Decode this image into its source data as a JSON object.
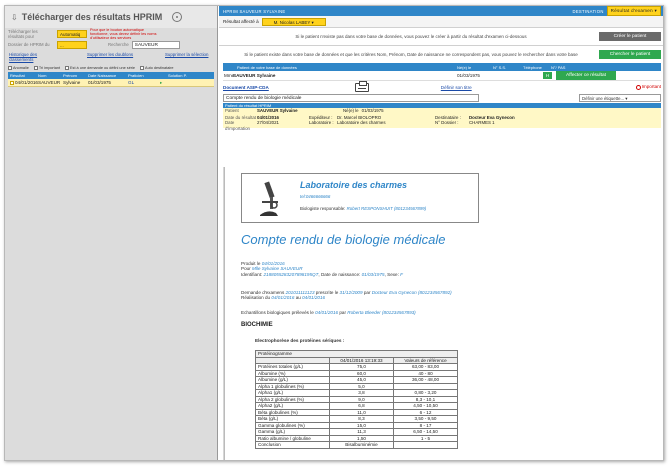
{
  "left": {
    "title": "Télécharger des résultats HPRIM",
    "telecharger_label": "Télécharger les résultats pour",
    "telecharger_value": "Automatiq",
    "warning": "Pour que le bouton automatique fonctionne, vous devez définir les noms d'utilisateur des services",
    "dossier_label": "Dossier de HPRIM du",
    "dossier_value": "...",
    "recherche_label": "Recherche",
    "recherche_value": "SAUVEUR",
    "links": [
      "Historique des classements",
      "Supprimer les doublons",
      "Supprimer la sélection"
    ],
    "checks": [
      "Anomalie",
      "Tri important",
      "Est à une demande ou défini une série",
      "Auto destinataire"
    ],
    "table_headers": [
      "Résultat",
      "Nom",
      "Prénom",
      "Date Naissance",
      "Praticien",
      "Solution P."
    ],
    "table_row": {
      "date": "04/01/2016",
      "nom": "SAUVEUR",
      "prenom": "Sylvaine",
      "naissance": "01/03/1975",
      "praticien": "GL"
    }
  },
  "right": {
    "topbar": "HPRIM SAUVEUR SYLVAINE",
    "destination_label": "DESTINATION",
    "destination_value": "Résultat d'examen",
    "affecte_label": "Résultat affecté à",
    "affecte_value": "M. Nicolas LABEY",
    "msg1": "Si le patient n'existe pas dans votre base de données, vous pouvez le créer à partir du résultat d'examen ci-dessous",
    "btn_create": "Créer le patient",
    "msg2": "Si le patient existe dans votre base de données et que les critères Nom, Prénom, Date de naissance ne correspondent pas, vous pouvez le rechercher dans votre base",
    "btn_search": "Chercher le patient",
    "pt_headers": [
      "Patient de votre base de données",
      "Né(e) le",
      "N° S.S.",
      "Téléphone",
      "N°/ PAS"
    ],
    "pt_row": {
      "civ": "Mme",
      "nom": "SAUVEUR Sylvaine",
      "naiss": "01/03/1975",
      "h": "H",
      "btn": "Affecter ce résultat"
    },
    "doc_label": "Document ASIP-CDA",
    "define_title": "Définir son titre",
    "important": "Important",
    "doc_title": "Compte rendu de biologie médicale",
    "dd": "Définir une étiquette...",
    "meta_bar": "Patient du résultat HPRIM",
    "meta": {
      "patient_k": "Patient",
      "patient_v": "SAUVEUR Sylvaine",
      "nele_k": "Né(e) le",
      "nele_v": "01/03/1975",
      "date_k": "Date du résultat",
      "date_v": "04/01/2016",
      "exp_k": "Expéditeur :",
      "exp_v": "Dr. Marcel BIOLOPRO",
      "dest_k": "Destinataire :",
      "dest_v": "Docteur Eva Gynecon",
      "imp_k": "Date d'importation",
      "imp_v": "27/04/2021",
      "lab_k": "Laboratoire :",
      "lab_v": "Laboratoire des charmes",
      "dos_k": "N° Dossier :",
      "dos_v": "CHARMES 1"
    }
  },
  "report": {
    "lab_name": "Laboratoire des charmes",
    "lab_tel": "tel:0466666666",
    "bio_label": "Biologiste responsable:",
    "bio_name": "Robert RESPONSHUIT (801234567899)",
    "h1": "Compte rendu de biologie médicale",
    "produit_le": "Produit le",
    "produit_date": "04/01/2016",
    "pour": "Pour",
    "pour_name": "Mlle Sylvaine SAUVEUR",
    "ident_label": "Identifiant:",
    "ident_value": "2188055283207898195QT",
    "naiss_label": ", Date de naissance:",
    "naiss_value": "01/03/1975",
    "sexe_label": ", Sexe:",
    "sexe_value": "F",
    "demande_label": "Demande d'examens",
    "demande_value": "201011111123",
    "prescrite": "prescrite le",
    "prescrite_date": "31/12/2009",
    "par": "par",
    "presc_name": "Docteur Eva Gynecon (801234567892)",
    "realisation": "Réalisation du",
    "real_from": "04/01/2016",
    "au": "au",
    "real_to": "04/01/2016",
    "echant": "Echantillons biologiques prélevés le",
    "echant_date": "04/01/2016",
    "echant_par": "par",
    "echant_name": "Roberta Bleeder (801234567893)",
    "section": "BIOCHIMIE",
    "subsection": "Electrophorèse des protéines sériques :",
    "table_caption": "Protéinogramme",
    "col_date": "04/01/2016 13:19:33",
    "col_ref": "Valeurs de référence",
    "rows": [
      [
        "Protéines totales (g/L)",
        "75,0",
        "63,00 - 83,00"
      ],
      [
        "Albumine (%)",
        "60,0",
        "40 - 80"
      ],
      [
        "Albumine (g/L)",
        "45,0",
        "36,00 - 48,00"
      ],
      [
        "Alpha 1 globulines (%)",
        "5,0",
        ""
      ],
      [
        "Alpha1 (g/L)",
        "3,8",
        "0,80 - 3,20"
      ],
      [
        "Alpha 2 globulines (%)",
        "9,0",
        "8,3 - 10,1"
      ],
      [
        "Alpha2 (g/L)",
        "6,8",
        "4,50 - 10,50"
      ],
      [
        "Béta globulines (%)",
        "11,0",
        "6 - 12"
      ],
      [
        "Béta (g/L)",
        "8,3",
        "3,50 - 9,50"
      ],
      [
        "Gamma globulines (%)",
        "15,0",
        "8 - 17"
      ],
      [
        "Gamma (g/L)",
        "11,3",
        "6,50 - 14,50"
      ],
      [
        "Ratio albumine / globuline",
        "1,50",
        "1 - 5"
      ],
      [
        "Conclusion",
        "Bisalbuminémie",
        ""
      ]
    ]
  }
}
